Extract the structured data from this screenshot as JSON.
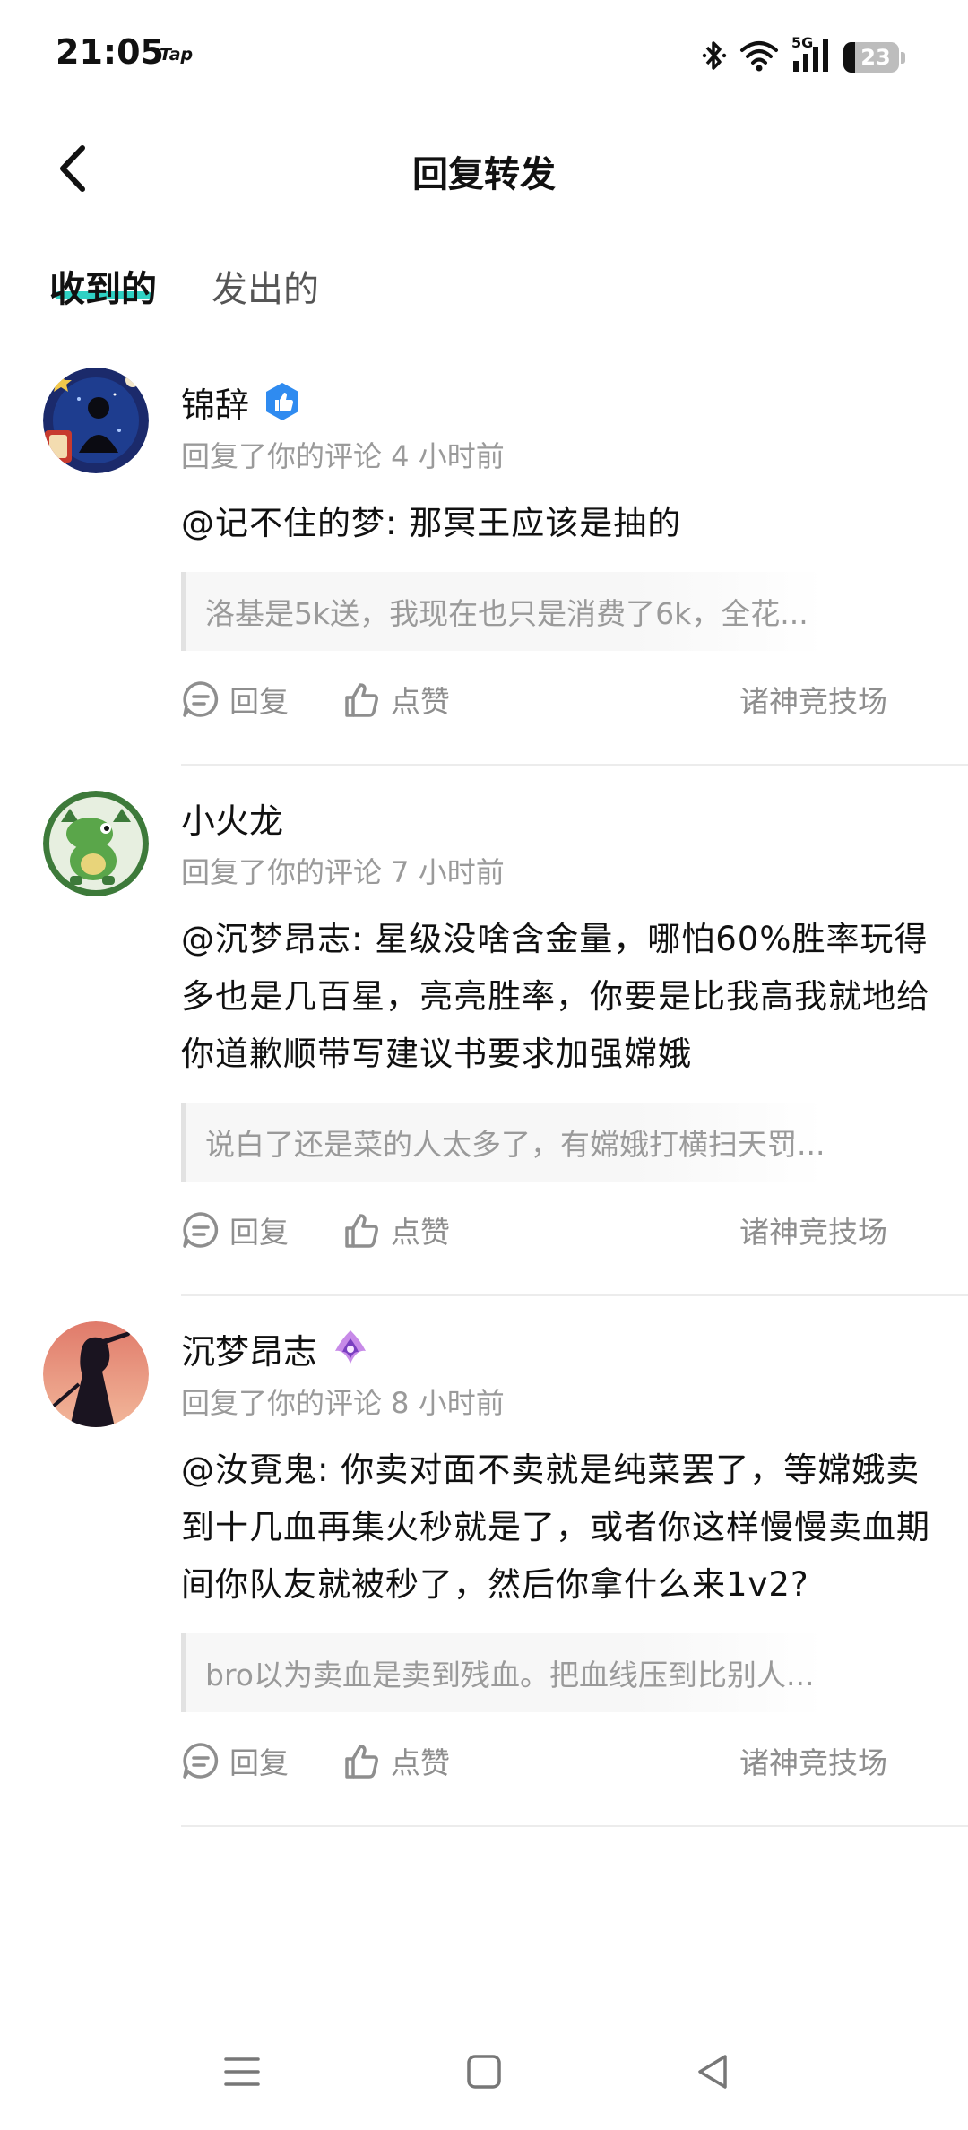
{
  "status_bar": {
    "time": "21:05",
    "app_indicator": "Tap",
    "battery_level": "23",
    "network": "5G",
    "icons": [
      "bluetooth-icon",
      "wifi-icon",
      "signal-icon",
      "battery-icon"
    ]
  },
  "header": {
    "title": "回复转发",
    "back_icon": "back-arrow-icon"
  },
  "tabs": [
    {
      "label": "收到的",
      "active": true
    },
    {
      "label": "发出的",
      "active": false
    }
  ],
  "accent_color": "#2fd1c4",
  "comments": [
    {
      "username": "锦辞",
      "badge": "verified-thumbs-up-badge",
      "meta": "回复了你的评论 4 小时前",
      "body": "@记不住的梦: 那冥王应该是抽的",
      "quote": "洛基是5k送，我现在也只是消费了6k，全花...",
      "reply_label": "回复",
      "like_label": "点赞",
      "forum": "诸神竞技场"
    },
    {
      "username": "小火龙",
      "badge": "",
      "meta": "回复了你的评论 7 小时前",
      "body": "@沉梦昂志: 星级没啥含金量，哪怕60%胜率玩得多也是几百星，亮亮胜率，你要是比我高我就地给你道歉顺带写建议书要求加强嫦娥",
      "quote": "说白了还是菜的人太多了，有嫦娥打横扫天罚...",
      "reply_label": "回复",
      "like_label": "点赞",
      "forum": "诸神竞技场"
    },
    {
      "username": "沉梦昂志",
      "badge": "purple-crest-badge",
      "meta": "回复了你的评论 8 小时前",
      "body": "@汝覔鬼: 你卖对面不卖就是纯菜罢了，等嫦娥卖到十几血再集火秒就是了，或者你这样慢慢卖血期间你队友就被秒了，然后你拿什么来1v2?",
      "quote": "bro以为卖血是卖到残血。把血线压到比别人...",
      "reply_label": "回复",
      "like_label": "点赞",
      "forum": "诸神竞技场"
    }
  ],
  "nav_bar": {
    "icons": [
      "menu-icon",
      "home-square-icon",
      "back-triangle-icon"
    ]
  }
}
